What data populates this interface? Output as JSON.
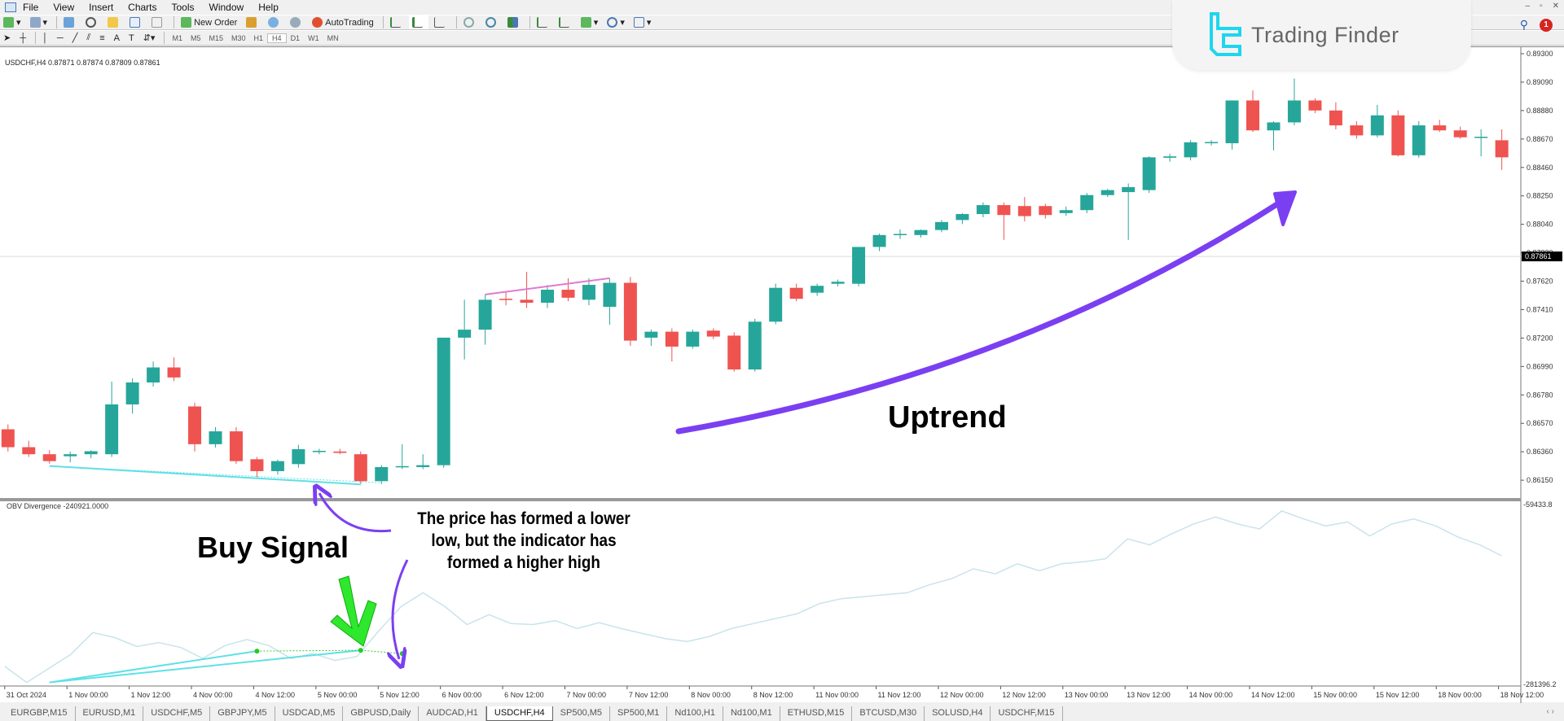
{
  "menu": [
    "File",
    "View",
    "Insert",
    "Charts",
    "Tools",
    "Window",
    "Help"
  ],
  "toolbar": {
    "new_order": "New Order",
    "autotrading": "AutoTrading"
  },
  "timeframes": [
    "M1",
    "M5",
    "M15",
    "M30",
    "H1",
    "H4",
    "D1",
    "W1",
    "MN"
  ],
  "active_timeframe": "H4",
  "window_controls": [
    "–",
    "▫",
    "✕"
  ],
  "notifications_count": "1",
  "logo_text": "Trading Finder",
  "chart": {
    "symbol_label": "USDCHF,H4  0.87871 0.87874 0.87809 0.87861",
    "indicator_label": "OBV Divergence -240921.0000",
    "current_price": "0.87861",
    "price_ticks": [
      "0.89300",
      "0.89090",
      "0.88880",
      "0.88670",
      "0.88460",
      "0.88250",
      "0.88040",
      "0.87830",
      "0.87620",
      "0.87410",
      "0.87200",
      "0.86990",
      "0.86780",
      "0.86570",
      "0.86360",
      "0.86150"
    ],
    "indicator_ticks": [
      "-59433.8",
      "-281396.2"
    ],
    "time_ticks": [
      "31 Oct 2024",
      "1 Nov 00:00",
      "1 Nov 12:00",
      "4 Nov 00:00",
      "4 Nov 12:00",
      "5 Nov 00:00",
      "5 Nov 12:00",
      "6 Nov 00:00",
      "6 Nov 12:00",
      "7 Nov 00:00",
      "7 Nov 12:00",
      "8 Nov 00:00",
      "8 Nov 12:00",
      "11 Nov 00:00",
      "11 Nov 12:00",
      "12 Nov 00:00",
      "12 Nov 12:00",
      "13 Nov 00:00",
      "13 Nov 12:00",
      "14 Nov 00:00",
      "14 Nov 12:00",
      "15 Nov 00:00",
      "15 Nov 12:00",
      "18 Nov 00:00",
      "18 Nov 12:00"
    ],
    "colors": {
      "bull": "#26a69a",
      "bear": "#ef5350",
      "obv": "#c9e3ec",
      "div_line": "#5fe0e6",
      "pink": "#e07ad0",
      "annot": "#7b3ff2",
      "buy_arrow": "#2ee82e"
    }
  },
  "chart_data": {
    "type": "candlestick",
    "candles": [
      [
        0.86584,
        0.8662,
        0.8642,
        0.86452
      ],
      [
        0.86452,
        0.865,
        0.8638,
        0.864
      ],
      [
        0.864,
        0.8643,
        0.8633,
        0.86349
      ],
      [
        0.86385,
        0.8642,
        0.8634,
        0.864
      ],
      [
        0.864,
        0.8643,
        0.8637,
        0.86422
      ],
      [
        0.864,
        0.86937,
        0.8638,
        0.86768
      ],
      [
        0.86768,
        0.8696,
        0.867,
        0.8693
      ],
      [
        0.8693,
        0.87085,
        0.869,
        0.87041
      ],
      [
        0.87041,
        0.87115,
        0.8694,
        0.86967
      ],
      [
        0.86753,
        0.8678,
        0.8642,
        0.86474
      ],
      [
        0.86474,
        0.866,
        0.8645,
        0.86569
      ],
      [
        0.86569,
        0.866,
        0.8633,
        0.86349
      ],
      [
        0.86363,
        0.8638,
        0.8623,
        0.86275
      ],
      [
        0.86275,
        0.8636,
        0.8625,
        0.86349
      ],
      [
        0.86327,
        0.8647,
        0.863,
        0.86437
      ],
      [
        0.86422,
        0.8644,
        0.864,
        0.86425
      ],
      [
        0.8642,
        0.8644,
        0.864,
        0.8641
      ],
      [
        0.864,
        0.8642,
        0.8618,
        0.86201
      ],
      [
        0.86201,
        0.8632,
        0.8618,
        0.86305
      ],
      [
        0.86305,
        0.86474,
        0.8629,
        0.86312
      ],
      [
        0.86305,
        0.864,
        0.8629,
        0.86319
      ],
      [
        0.86319,
        0.87261,
        0.863,
        0.87261
      ],
      [
        0.87261,
        0.87541,
        0.871,
        0.8732
      ],
      [
        0.8732,
        0.8758,
        0.87209,
        0.87541
      ],
      [
        0.87548,
        0.876,
        0.875,
        0.87541
      ],
      [
        0.87541,
        0.87747,
        0.8748,
        0.87519
      ],
      [
        0.87519,
        0.8765,
        0.8748,
        0.87615
      ],
      [
        0.87615,
        0.877,
        0.8753,
        0.87556
      ],
      [
        0.87541,
        0.877,
        0.875,
        0.87651
      ],
      [
        0.87489,
        0.877,
        0.87357,
        0.87666
      ],
      [
        0.87666,
        0.8771,
        0.872,
        0.87239
      ],
      [
        0.87261,
        0.8732,
        0.872,
        0.87305
      ],
      [
        0.87305,
        0.8733,
        0.87085,
        0.87195
      ],
      [
        0.87195,
        0.8732,
        0.8718,
        0.87305
      ],
      [
        0.87313,
        0.8733,
        0.8725,
        0.87269
      ],
      [
        0.87276,
        0.873,
        0.8701,
        0.87026
      ],
      [
        0.87026,
        0.874,
        0.8701,
        0.87379
      ],
      [
        0.87379,
        0.8766,
        0.8736,
        0.87629
      ],
      [
        0.87629,
        0.8766,
        0.8753,
        0.87548
      ],
      [
        0.87593,
        0.8766,
        0.8757,
        0.87644
      ],
      [
        0.87659,
        0.8769,
        0.8764,
        0.87674
      ],
      [
        0.87659,
        0.87931,
        0.8764,
        0.87931
      ],
      [
        0.87931,
        0.8803,
        0.879,
        0.88019
      ],
      [
        0.8802,
        0.8806,
        0.8799,
        0.88027
      ],
      [
        0.88019,
        0.8806,
        0.88,
        0.88056
      ],
      [
        0.88056,
        0.8813,
        0.8804,
        0.88115
      ],
      [
        0.8813,
        0.8818,
        0.881,
        0.88174
      ],
      [
        0.88174,
        0.8826,
        0.8815,
        0.8824
      ],
      [
        0.8824,
        0.8826,
        0.87983,
        0.88167
      ],
      [
        0.88233,
        0.883,
        0.8812,
        0.88159
      ],
      [
        0.88233,
        0.8825,
        0.8814,
        0.88167
      ],
      [
        0.88181,
        0.8823,
        0.8816,
        0.88203
      ],
      [
        0.88203,
        0.8833,
        0.8818,
        0.88314
      ],
      [
        0.88314,
        0.8836,
        0.883,
        0.88351
      ],
      [
        0.88336,
        0.884,
        0.87983,
        0.88373
      ],
      [
        0.88351,
        0.886,
        0.8833,
        0.88593
      ],
      [
        0.8859,
        0.8862,
        0.8856,
        0.886
      ],
      [
        0.88593,
        0.8872,
        0.8857,
        0.88704
      ],
      [
        0.887,
        0.8872,
        0.8868,
        0.88706
      ],
      [
        0.88697,
        0.89013,
        0.8865,
        0.89013
      ],
      [
        0.89013,
        0.89087,
        0.8878,
        0.88792
      ],
      [
        0.88792,
        0.8886,
        0.88645,
        0.88851
      ],
      [
        0.88851,
        0.89175,
        0.8883,
        0.89013
      ],
      [
        0.89013,
        0.8903,
        0.8892,
        0.88939
      ],
      [
        0.88939,
        0.89,
        0.888,
        0.88829
      ],
      [
        0.88829,
        0.8886,
        0.8873,
        0.88755
      ],
      [
        0.88755,
        0.8898,
        0.8874,
        0.88903
      ],
      [
        0.88903,
        0.8894,
        0.886,
        0.88608
      ],
      [
        0.88608,
        0.8886,
        0.8859,
        0.88829
      ],
      [
        0.88829,
        0.8887,
        0.8878,
        0.88792
      ],
      [
        0.88792,
        0.8882,
        0.8873,
        0.88741
      ],
      [
        0.88741,
        0.888,
        0.886,
        0.88745
      ],
      [
        0.88719,
        0.888,
        0.885,
        0.88593
      ]
    ],
    "obv": [
      -256834,
      -276489,
      -259321,
      -242153,
      -215174,
      -221306,
      -232342,
      -227437,
      -233569,
      -247058,
      -231116,
      -223758,
      -231116,
      -247058,
      -240926,
      -249511,
      -244605,
      -212722,
      -183290,
      -166122,
      -183290,
      -205364,
      -193101,
      -204137,
      -205364,
      -200459,
      -210269,
      -202911,
      -210269,
      -216400,
      -222532,
      -226211,
      -220079,
      -210269,
      -204137,
      -198006,
      -191874,
      -179611,
      -173480,
      -171027,
      -168575,
      -166122,
      -156312,
      -148954,
      -136691,
      -142822,
      -130559,
      -139144,
      -130559,
      -128107,
      -124428,
      -99902,
      -107260,
      -93770,
      -81507,
      -72923,
      -81507,
      -87639,
      -65565,
      -75376,
      -83960,
      -79055,
      -96223,
      -81507,
      -75376,
      -83960,
      -97449,
      -107260,
      -120749
    ],
    "price_range": [
      0.8605,
      0.8935
    ],
    "obv_range": [
      -281396.2,
      -59433.8
    ]
  },
  "annotations": {
    "uptrend": "Uptrend",
    "buy_signal": "Buy Signal",
    "explanation": [
      "The price has formed a lower",
      "low, but the indicator has",
      "formed a higher high"
    ]
  },
  "tabs": [
    "EURGBP,M15",
    "EURUSD,M1",
    "USDCHF,M5",
    "GBPJPY,M5",
    "USDCAD,M5",
    "GBPUSD,Daily",
    "AUDCAD,H1",
    "USDCHF,H4",
    "SP500,M5",
    "SP500,M1",
    "Nd100,H1",
    "Nd100,M1",
    "ETHUSD,M15",
    "BTCUSD,M30",
    "SOLUSD,H4",
    "USDCHF,M15"
  ],
  "active_tab": "USDCHF,H4"
}
